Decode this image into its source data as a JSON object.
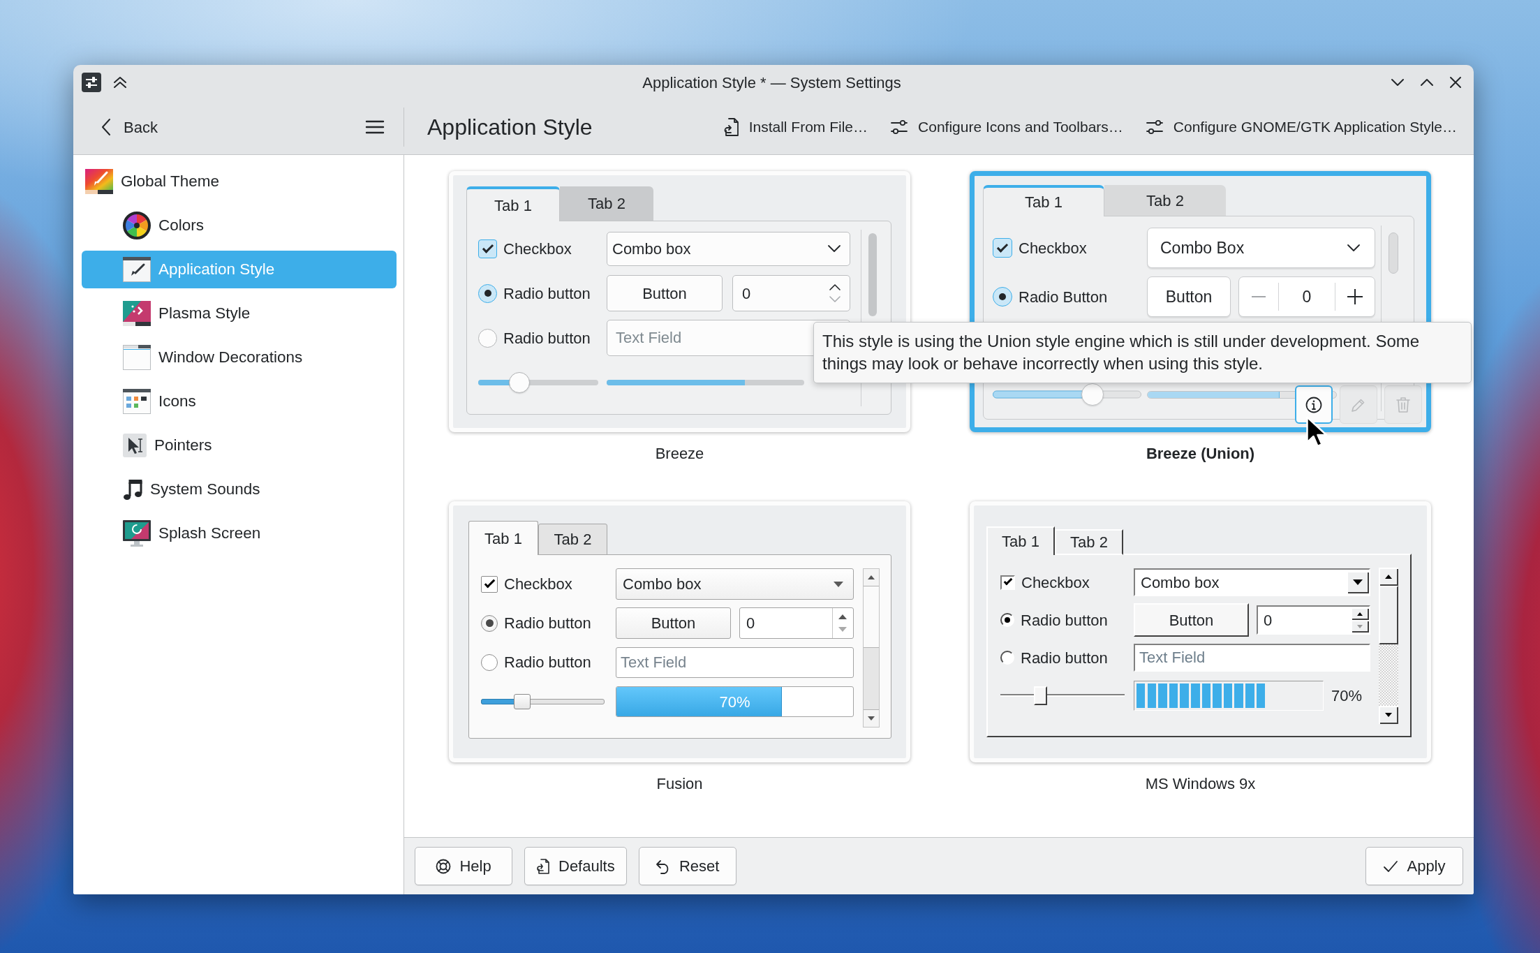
{
  "window": {
    "title": "Application Style * — System Settings"
  },
  "header": {
    "back": "Back",
    "page_title": "Application Style",
    "actions": [
      {
        "kind": "install",
        "label": "Install From File…"
      },
      {
        "kind": "configure",
        "label": "Configure Icons and Toolbars…"
      },
      {
        "kind": "configure",
        "label": "Configure GNOME/GTK Application Style…"
      }
    ]
  },
  "sidebar": {
    "items": [
      {
        "label": "Global Theme",
        "selected": false,
        "children": [
          {
            "label": "Colors",
            "selected": false
          },
          {
            "label": "Application Style",
            "selected": true
          },
          {
            "label": "Plasma Style",
            "selected": false
          },
          {
            "label": "Window Decorations",
            "selected": false
          },
          {
            "label": "Icons",
            "selected": false
          },
          {
            "label": "Pointers",
            "selected": false
          },
          {
            "label": "System Sounds",
            "selected": false
          },
          {
            "label": "Splash Screen",
            "selected": false
          }
        ]
      }
    ]
  },
  "styles": [
    {
      "name": "Breeze",
      "kind": "breeze",
      "selected": false,
      "tabs": [
        {
          "label": "Tab 1",
          "selected": true
        },
        {
          "label": "Tab 2",
          "selected": false
        }
      ],
      "checkbox": {
        "label": "Checkbox",
        "checked": true
      },
      "combo_box": "Combo box",
      "radio_buttons": [
        {
          "label": "Radio button",
          "selected": true
        },
        {
          "label": "Radio button",
          "selected": false
        }
      ],
      "button": "Button",
      "spin_box": "0",
      "text_field": {
        "placeholder": "Text Field"
      },
      "slider": {
        "level": 0.31
      },
      "progress": {
        "level": 0.7
      }
    },
    {
      "name": "Breeze (Union)",
      "kind": "union",
      "selected": true,
      "tabs": [
        {
          "label": "Tab 1",
          "selected": true
        },
        {
          "label": "Tab 2",
          "selected": false
        }
      ],
      "checkbox": {
        "label": "Checkbox",
        "checked": true
      },
      "combo_box": "Combo Box",
      "radio_buttons": [
        {
          "label": "Radio Button",
          "selected": true
        }
      ],
      "button": "Button",
      "spin_box": "0",
      "slider": {
        "level": 0.7
      },
      "progress": {
        "level": 0.7
      },
      "actions": [
        {
          "kind": "info",
          "hovered": true,
          "disabled": false
        },
        {
          "kind": "edit",
          "hovered": false,
          "disabled": true
        },
        {
          "kind": "delete",
          "hovered": false,
          "disabled": true
        }
      ]
    },
    {
      "name": "Fusion",
      "kind": "fusion",
      "selected": false,
      "tabs": [
        {
          "label": "Tab 1",
          "selected": true
        },
        {
          "label": "Tab 2",
          "selected": false
        }
      ],
      "checkbox": {
        "label": "Checkbox",
        "checked": true
      },
      "combo_box": "Combo box",
      "radio_buttons": [
        {
          "label": "Radio button",
          "selected": true
        },
        {
          "label": "Radio button",
          "selected": false
        }
      ],
      "button": "Button",
      "spin_box": "0",
      "text_field": {
        "placeholder": "Text Field"
      },
      "slider": {
        "level": 0.31
      },
      "progress": {
        "level": 0.7,
        "reading": "70%"
      }
    },
    {
      "name": "MS Windows 9x",
      "kind": "windows9x",
      "selected": false,
      "tabs": [
        {
          "label": "Tab 1",
          "selected": true
        },
        {
          "label": "Tab 2",
          "selected": false
        }
      ],
      "checkbox": {
        "label": "Checkbox",
        "checked": true
      },
      "combo_box": "Combo box",
      "radio_buttons": [
        {
          "label": "Radio button",
          "selected": true
        },
        {
          "label": "Radio button",
          "selected": false
        }
      ],
      "button": "Button",
      "spin_box": "0",
      "text_field": {
        "placeholder": "Text Field"
      },
      "slider": {
        "level": 0.3
      },
      "progress": {
        "level": 0.7,
        "reading": "70%"
      }
    }
  ],
  "tooltip": {
    "text": "This style is using the Union style engine which is still under development. Some things may look or behave incorrectly when using this style."
  },
  "footer": {
    "buttons": [
      {
        "kind": "help",
        "label": "Help"
      },
      {
        "kind": "defaults",
        "label": "Defaults"
      },
      {
        "kind": "reset",
        "label": "Reset"
      },
      {
        "kind": "apply",
        "label": "Apply"
      }
    ]
  }
}
